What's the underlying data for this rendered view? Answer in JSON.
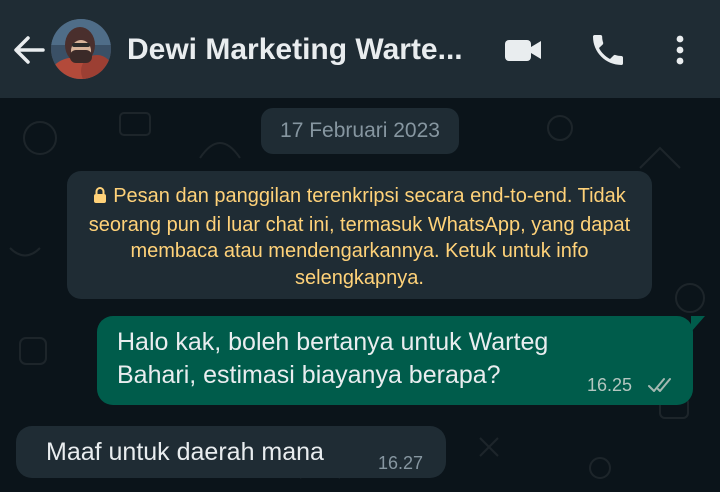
{
  "header": {
    "title": "Dewi Marketing Warte...",
    "back_icon": "arrow-left-icon",
    "video_icon": "video-camera-icon",
    "call_icon": "phone-icon",
    "menu_icon": "kebab-menu-icon"
  },
  "chat": {
    "date_chip": "17 Februari 2023",
    "encryption_notice": "Pesan dan panggilan terenkripsi secara end-to-end. Tidak seorang pun di luar chat ini, termasuk WhatsApp, yang dapat membaca atau mendengarkannya. Ketuk untuk info selengkapnya.",
    "messages": [
      {
        "direction": "outgoing",
        "text": "Halo kak, boleh bertanya untuk Warteg Bahari, estimasi biayanya berapa?",
        "time": "16.25",
        "status": "read"
      },
      {
        "direction": "incoming",
        "text": "Maaf untuk daerah mana",
        "time": "16.27"
      }
    ]
  },
  "colors": {
    "header_bg": "#1f2c34",
    "chat_bg": "#0b141a",
    "outgoing_bubble": "#005c4b",
    "incoming_bubble": "#1f2c34",
    "encryption_text": "#ffd279"
  }
}
